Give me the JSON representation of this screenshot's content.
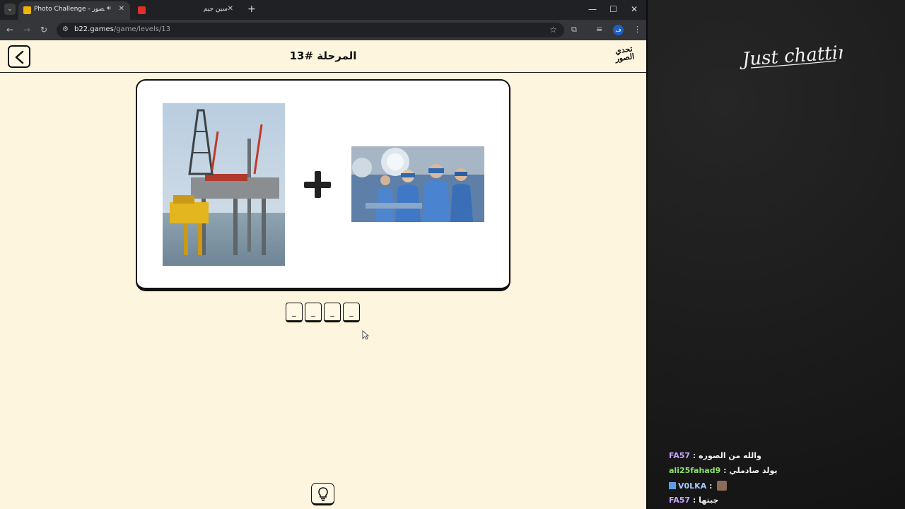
{
  "browser": {
    "tabs": [
      {
        "title": "Photo Challenge - تحدي الصور",
        "active": true,
        "favicon_color": "#f2b300"
      },
      {
        "title": "سين جيم",
        "active": false,
        "favicon_color": "#e0302a"
      }
    ],
    "url_host": "b22.games",
    "url_path": "/game/levels/13",
    "profile_initial": "ف"
  },
  "page": {
    "level_title": "المرحلة #13",
    "logo_text": "تحدي الصور",
    "puzzle": {
      "image_1": "oil-rig-photo",
      "operator": "+",
      "image_2": "surgeons-photo"
    },
    "answer_slots": [
      "_",
      "_",
      "_",
      "_"
    ],
    "hint_icon": "lightbulb-icon"
  },
  "stream": {
    "category_title": "Just chatting",
    "chat": [
      {
        "user": "FA57",
        "user_color": "#c7a4ff",
        "message": "والله من الصوره",
        "badge": false,
        "emote": false
      },
      {
        "user": "ali25fahad9",
        "user_color": "#8ee06a",
        "message": "يولد صادملي",
        "badge": false,
        "emote": false
      },
      {
        "user": "V0LKA",
        "user_color": "#a8c8ff",
        "message": "",
        "badge": true,
        "emote": true
      },
      {
        "user": "FA57",
        "user_color": "#c7a4ff",
        "message": "جبتها",
        "badge": false,
        "emote": false
      }
    ]
  },
  "colors": {
    "page_bg": "#fdf5dd",
    "card_border": "#111111",
    "panel_bg": "#1b1b1b"
  }
}
